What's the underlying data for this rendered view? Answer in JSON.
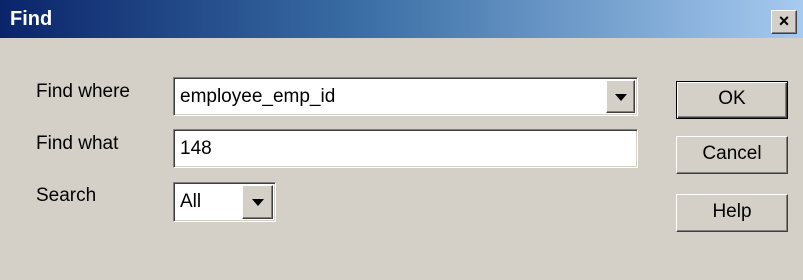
{
  "window": {
    "title": "Find",
    "close_glyph": "×"
  },
  "form": {
    "find_where": {
      "label": "Find where",
      "value": "employee_emp_id"
    },
    "find_what": {
      "label": "Find what",
      "value": "148"
    },
    "search": {
      "label": "Search",
      "value": "All"
    }
  },
  "buttons": {
    "ok": "OK",
    "cancel": "Cancel",
    "help": "Help"
  },
  "icons": {
    "close": "close-icon",
    "dropdown": "chevron-down-icon"
  },
  "colors": {
    "titlebar_start": "#0a246a",
    "titlebar_end": "#a6caf0",
    "dialog_bg": "#d4d0c8"
  }
}
